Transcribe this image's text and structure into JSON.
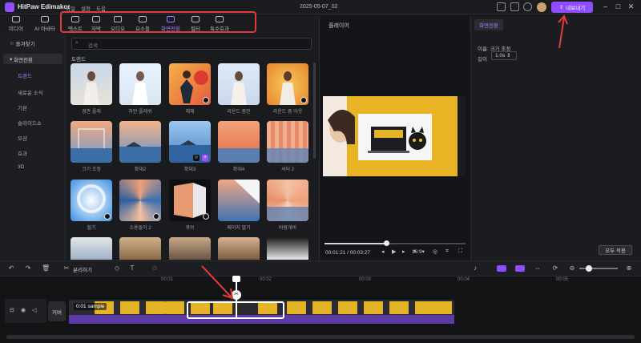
{
  "app": {
    "name": "HitPaw Edimakor",
    "menu": [
      "파일",
      "설정",
      "도움"
    ],
    "project_title": "2025-05-07_02",
    "export_label": "내보내기"
  },
  "tooltabs": [
    {
      "label": "미디어",
      "icon": "media-icon"
    },
    {
      "label": "AI 아바타",
      "icon": "ai-avatar-icon"
    },
    {
      "label": "텍스트",
      "icon": "text-icon"
    },
    {
      "label": "자막",
      "icon": "subtitle-icon"
    },
    {
      "label": "오디오",
      "icon": "audio-icon"
    },
    {
      "label": "요소들",
      "icon": "elements-icon"
    },
    {
      "label": "화면전환",
      "icon": "transition-icon",
      "active": true
    },
    {
      "label": "필터",
      "icon": "filter-icon"
    },
    {
      "label": "특수효과",
      "icon": "effects-icon"
    }
  ],
  "sidebar": {
    "favorites": "즐겨찾기",
    "group": "화면전환",
    "items": [
      "트렌드",
      "새로운 소식",
      "기본",
      "슬라이드쇼",
      "모션",
      "효과",
      "3D"
    ]
  },
  "browser": {
    "search_placeholder": "검색",
    "section": "트렌드",
    "thumbs": [
      {
        "label": "경관 플래"
      },
      {
        "label": "하얀 플래쉬"
      },
      {
        "label": "해체"
      },
      {
        "label": "라운드 줌인"
      },
      {
        "label": "라운드 줌 아웃"
      },
      {
        "label": "크기 조정"
      },
      {
        "label": "확대2"
      },
      {
        "label": "확대3"
      },
      {
        "label": "확대4"
      },
      {
        "label": "셔터 2"
      },
      {
        "label": "헐기"
      },
      {
        "label": "소용돌이 2"
      },
      {
        "label": "큐브"
      },
      {
        "label": "페이지 말기"
      },
      {
        "label": "바람개비"
      }
    ]
  },
  "player": {
    "title": "플레이어",
    "time": "00:01:21 / 00:03:27",
    "ratio": "16:9"
  },
  "right_panel": {
    "tab": "화면전환",
    "name_line": "이름: 크기 조정",
    "duration_label": "길이",
    "duration_value": "1.0s",
    "apply_all": "모두 적용"
  },
  "timeline": {
    "split_label": "분리하기",
    "ticks": [
      "00:01",
      "00:02",
      "00:03",
      "00:04",
      "00:05"
    ],
    "cover_label": "커버",
    "clip_label": "0:01 sample"
  },
  "colors": {
    "accent": "#8f4dff",
    "annotation": "#e23b3b"
  }
}
